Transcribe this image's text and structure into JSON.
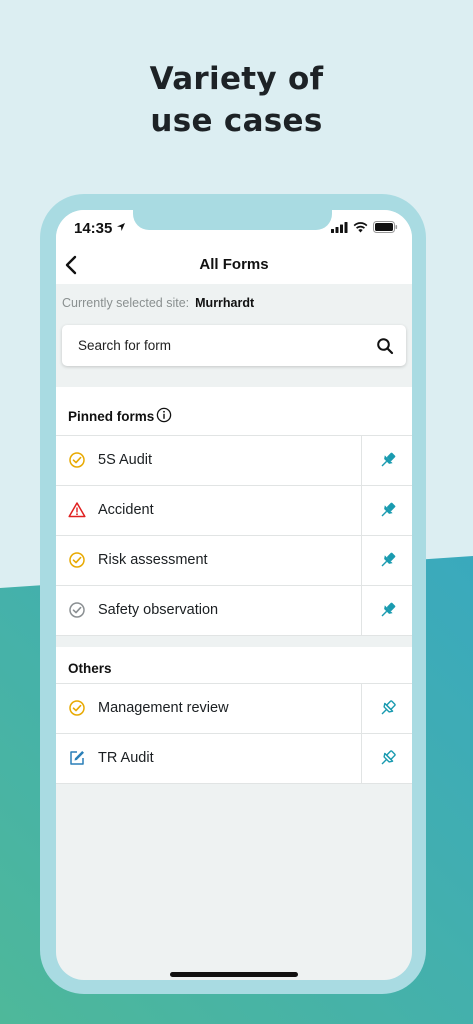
{
  "headline": {
    "line1": "Variety of",
    "line2": "use cases"
  },
  "status_bar": {
    "time": "14:35"
  },
  "nav": {
    "title": "All Forms",
    "back_icon": "chevron-left-icon"
  },
  "site": {
    "label": "Currently selected site:",
    "name": "Murrhardt"
  },
  "search": {
    "placeholder": "Search for form",
    "icon": "search-icon"
  },
  "pinned": {
    "title": "Pinned forms",
    "items": [
      {
        "label": "5S Audit",
        "status_icon": "check-circle-icon",
        "status_color": "#e8a900",
        "pinned": true
      },
      {
        "label": "Accident",
        "status_icon": "warning-triangle-icon",
        "status_color": "#e02020",
        "pinned": true
      },
      {
        "label": "Risk assessment",
        "status_icon": "check-circle-icon",
        "status_color": "#e8a900",
        "pinned": true
      },
      {
        "label": "Safety observation",
        "status_icon": "check-circle-icon",
        "status_color": "#8a8f92",
        "pinned": true
      }
    ]
  },
  "others": {
    "title": "Others",
    "items": [
      {
        "label": "Management review",
        "status_icon": "check-circle-icon",
        "status_color": "#e8a900",
        "pinned": false
      },
      {
        "label": "TR Audit",
        "status_icon": "edit-square-icon",
        "status_color": "#2a7fb8",
        "pinned": false
      }
    ]
  },
  "colors": {
    "accent": "#1a9bb0",
    "background": "#dceef2",
    "phone_frame": "#a9dbe2",
    "teal_band": "#3aa7b2"
  }
}
